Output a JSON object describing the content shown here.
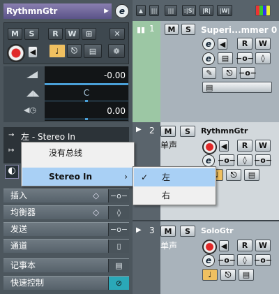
{
  "inspector": {
    "title": "RythmnGtr",
    "buttons": {
      "m": "M",
      "s": "S",
      "r": "R",
      "w": "W"
    },
    "fader_values": [
      "-0.00",
      "C",
      "0.00"
    ],
    "routing_input": "左 - Stereo In",
    "sections": [
      {
        "label": "插入"
      },
      {
        "label": "均衡器"
      },
      {
        "label": "发送"
      },
      {
        "label": "通道"
      },
      {
        "label": "记事本"
      },
      {
        "label": "快速控制"
      }
    ]
  },
  "toolbar": {
    "tab_labels": [
      "|||",
      ":|S|",
      "|R|",
      "|W|"
    ]
  },
  "tracks": [
    {
      "num": "1",
      "name": "Superi...mmer 0",
      "sub": ""
    },
    {
      "num": "2",
      "name": "RythmnGtr",
      "sub": "单声"
    },
    {
      "num": "3",
      "name": "SoloGtr",
      "sub": "单声"
    }
  ],
  "context_menu": {
    "items": [
      "没有总线",
      "Stereo In"
    ],
    "submenu": {
      "items": [
        "左",
        "右"
      ],
      "checked": "左"
    }
  },
  "colors": {
    "accent_orange": "#f0c060",
    "highlight": "#a9d0f5",
    "track1": "#9cc7a4",
    "quick_control": "#2aa8b8"
  }
}
